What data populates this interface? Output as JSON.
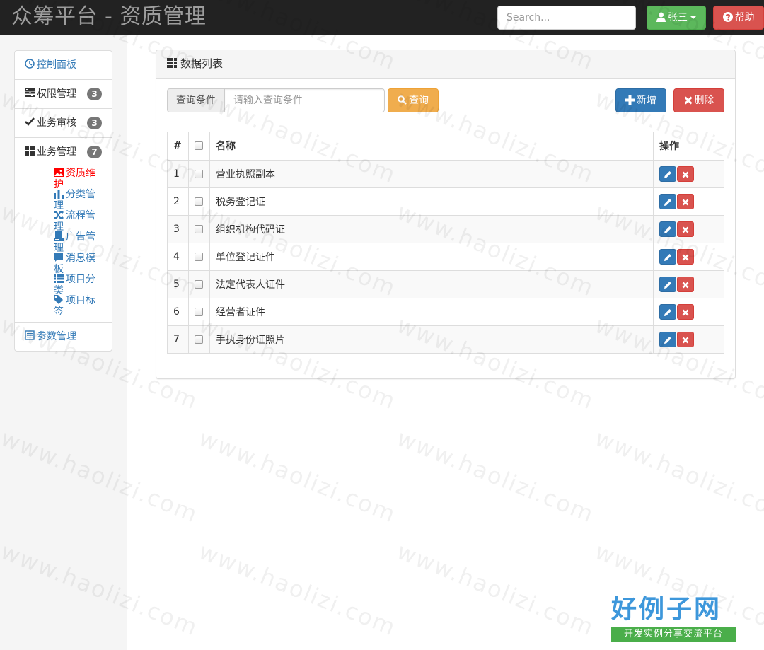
{
  "navbar": {
    "brand": "众筹平台 - 资质管理",
    "search_placeholder": "Search...",
    "user_label": "张三",
    "help_label": "帮助"
  },
  "sidebar": {
    "items": [
      {
        "label": "控制面板",
        "icon": "dashboard-icon"
      },
      {
        "label": "权限管理",
        "badge": "3",
        "icon": "tasks-icon"
      },
      {
        "label": "业务审核",
        "badge": "3",
        "icon": "check-icon"
      },
      {
        "label": "业务管理",
        "badge": "7",
        "icon": "th-large-icon"
      },
      {
        "label": "参数管理",
        "icon": "list-alt-icon"
      }
    ],
    "sub_items": [
      {
        "label": "资质维护",
        "icon": "picture-icon",
        "active": true
      },
      {
        "label": "分类管理",
        "icon": "equalizer-icon"
      },
      {
        "label": "流程管理",
        "icon": "random-icon"
      },
      {
        "label": "广告管理",
        "icon": "hdd-icon"
      },
      {
        "label": "消息模板",
        "icon": "comment-icon"
      },
      {
        "label": "项目分类",
        "icon": "list-icon"
      },
      {
        "label": "项目标签",
        "icon": "tags-icon"
      }
    ]
  },
  "panel": {
    "title": "数据列表",
    "query_addon": "查询条件",
    "query_placeholder": "请输入查询条件",
    "query_button": "查询",
    "add_button": "新增",
    "delete_button": "删除"
  },
  "table": {
    "headers": {
      "index": "#",
      "name": "名称",
      "ops": "操作"
    },
    "rows": [
      {
        "index": "1",
        "name": "营业执照副本"
      },
      {
        "index": "2",
        "name": "税务登记证"
      },
      {
        "index": "3",
        "name": "组织机构代码证"
      },
      {
        "index": "4",
        "name": "单位登记证件"
      },
      {
        "index": "5",
        "name": "法定代表人证件"
      },
      {
        "index": "6",
        "name": "经营者证件"
      },
      {
        "index": "7",
        "name": "手执身份证照片"
      }
    ]
  },
  "watermark": {
    "text": "www.haolizi.com",
    "logo_main": "好例子网",
    "logo_sub": "开发实例分享交流平台"
  },
  "colors": {
    "navbar_bg": "#222222",
    "primary": "#337ab7",
    "success": "#5cb85c",
    "danger": "#d9534f",
    "warning": "#f0ad4e",
    "active_sub_item": "#ff0000"
  }
}
